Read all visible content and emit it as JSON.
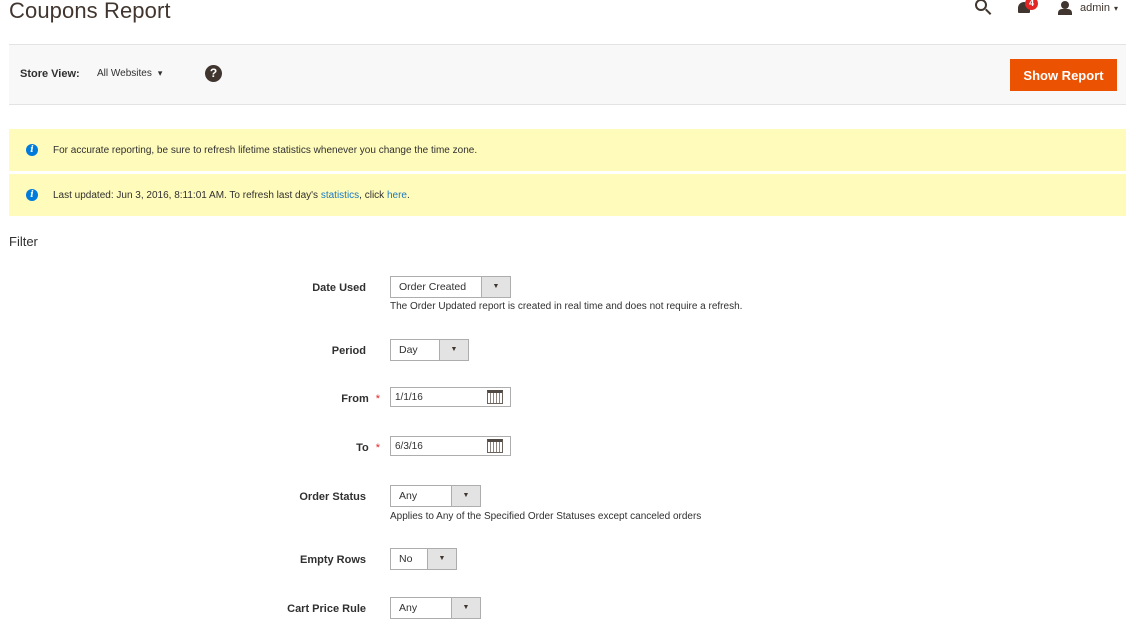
{
  "header": {
    "title": "Coupons Report",
    "notifications_count": "4",
    "user_label": "admin",
    "caret": "▾"
  },
  "toolbar": {
    "store_view_label": "Store View:",
    "store_view_value": "All Websites",
    "caret": "▾",
    "help_glyph": "?",
    "show_report_label": "Show Report"
  },
  "messages": [
    {
      "text": "For accurate reporting, be sure to refresh lifetime statistics whenever you change the time zone."
    },
    {
      "prefix": "Last updated: Jun 3, 2016, 8:11:01 AM. To refresh last day's ",
      "link1": "statistics",
      "middle": ", click ",
      "link2": "here",
      "suffix": "."
    }
  ],
  "info_glyph": "i",
  "filter": {
    "title": "Filter",
    "required_mark": "*",
    "arrow": "▼",
    "date_used": {
      "label": "Date Used",
      "value": "Order Created",
      "note": "The Order Updated report is created in real time and does not require a refresh."
    },
    "period": {
      "label": "Period",
      "value": "Day"
    },
    "from": {
      "label": "From",
      "value": "1/1/16"
    },
    "to": {
      "label": "To",
      "value": "6/3/16"
    },
    "order_status": {
      "label": "Order Status",
      "value": "Any",
      "note": "Applies to Any of the Specified Order Statuses except canceled orders"
    },
    "empty_rows": {
      "label": "Empty Rows",
      "value": "No"
    },
    "cart_price_rule": {
      "label": "Cart Price Rule",
      "value": "Any"
    }
  }
}
